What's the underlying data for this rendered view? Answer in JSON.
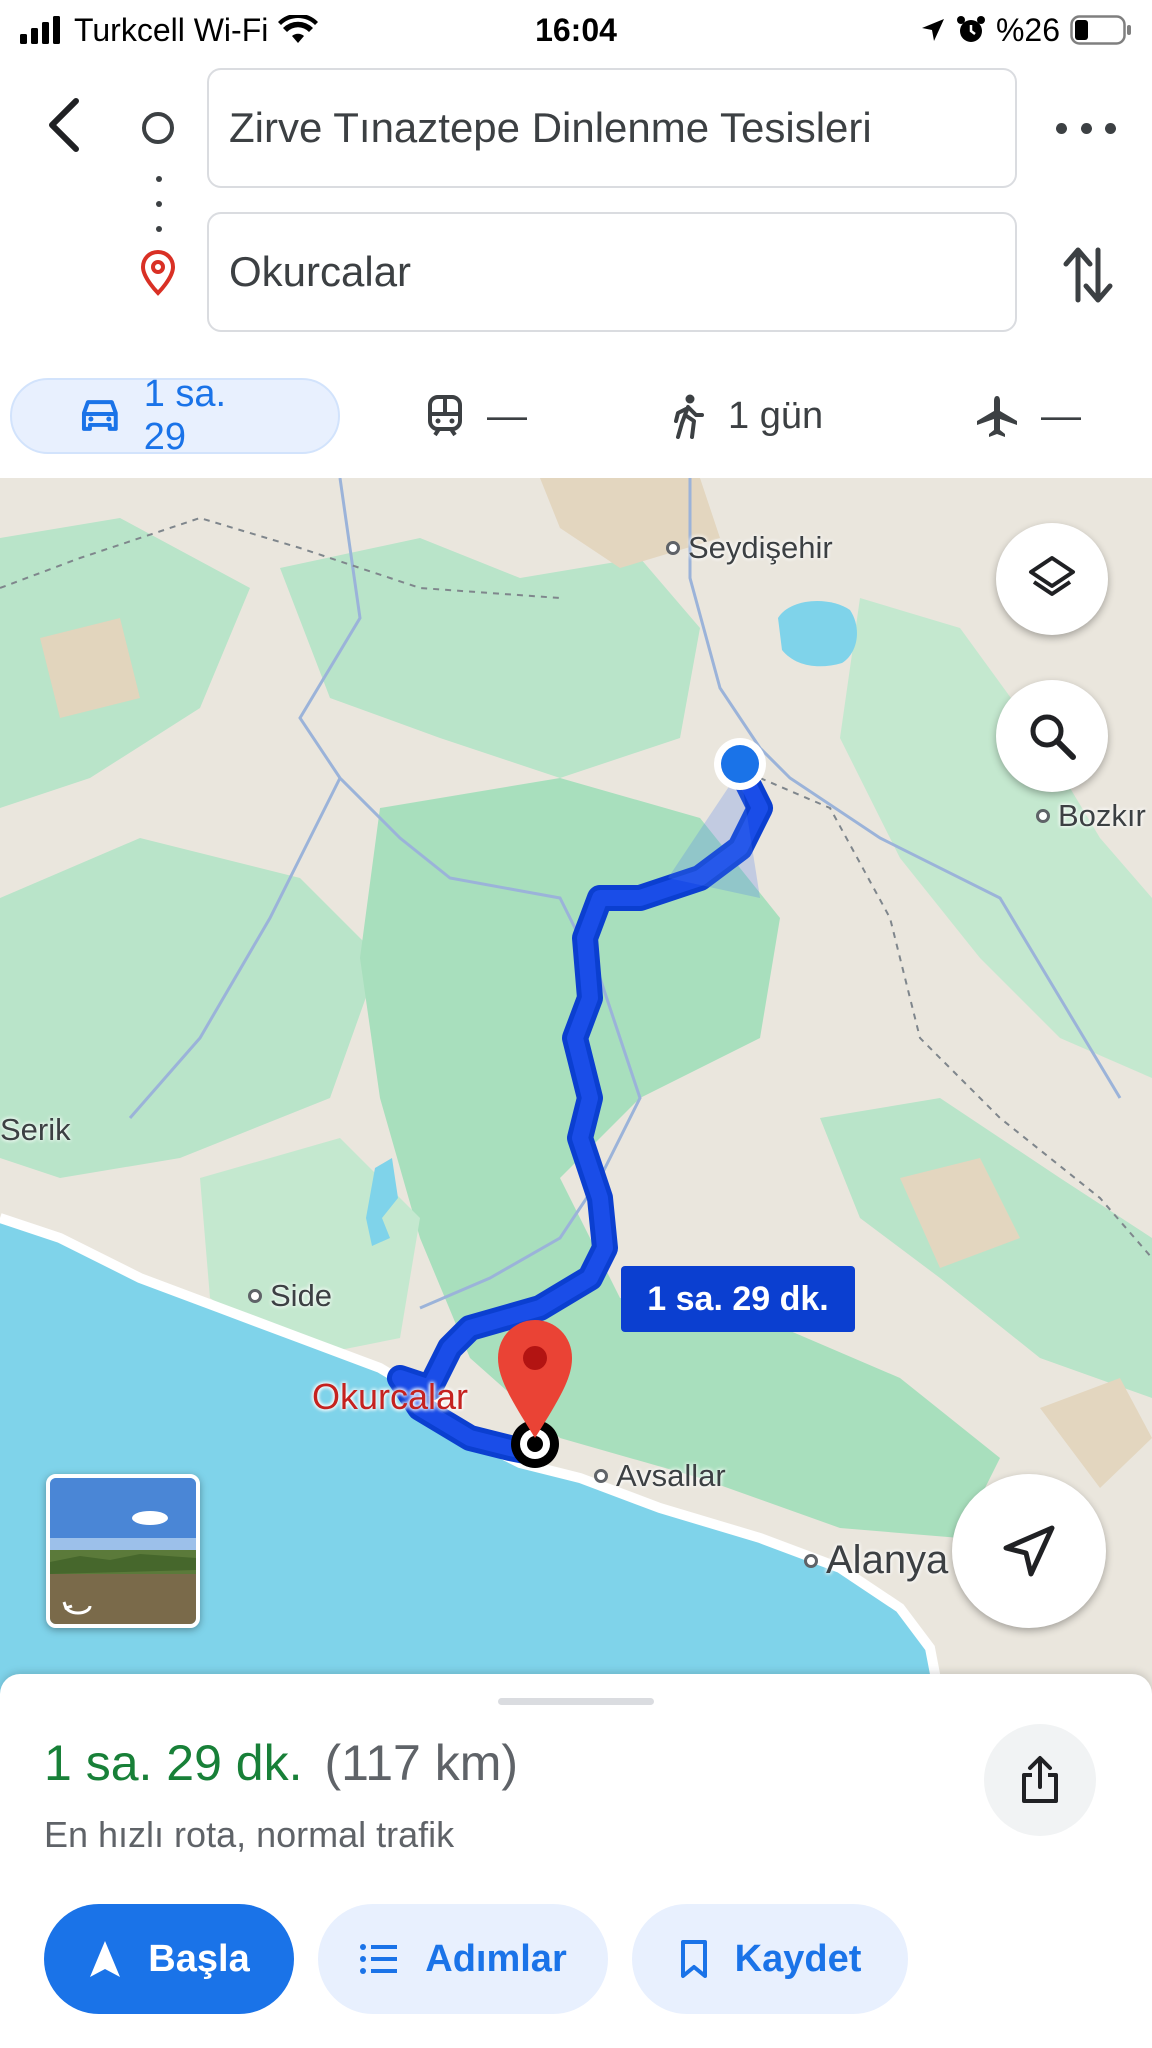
{
  "status_bar": {
    "carrier": "Turkcell Wi-Fi",
    "time": "16:04",
    "battery": "%26",
    "icons": [
      "signal-icon",
      "wifi-icon",
      "location-arrow-icon",
      "alarm-icon",
      "battery-icon"
    ]
  },
  "directions": {
    "origin": "Zirve Tınaztepe Dinlenme Tesisleri",
    "destination": "Okurcalar",
    "icons": [
      "back-icon",
      "origin-circle-icon",
      "destination-pin-icon",
      "more-icon",
      "swap-icon"
    ]
  },
  "modes": [
    {
      "name": "drive",
      "icon": "car-icon",
      "label": "1 sa. 29",
      "active": true
    },
    {
      "name": "transit",
      "icon": "train-icon",
      "label": "—",
      "active": false
    },
    {
      "name": "walk",
      "icon": "walk-icon",
      "label": "1 gün",
      "active": false
    },
    {
      "name": "flight",
      "icon": "plane-icon",
      "label": "—",
      "active": false
    }
  ],
  "map": {
    "places": {
      "seydisehir": "Seydişehir",
      "bozkir": "Bozkır",
      "serik": "Serik",
      "side": "Side",
      "avsallar": "Avsallar",
      "alanya": "Alanya",
      "okurcalar": "Okurcalar"
    },
    "route_time": "1 sa. 29 dk.",
    "route_color": "#1a3de8",
    "colors": {
      "land": "#eae6dd",
      "forest": "#b9e4c9",
      "water": "#7fd3ea"
    },
    "controls": [
      "layers-icon",
      "search-icon",
      "navigate-icon"
    ]
  },
  "summary": {
    "duration": "1 sa. 29 dk.",
    "distance": "(117 km)",
    "note": "En hızlı rota, normal trafik",
    "duration_color": "#188038"
  },
  "actions": {
    "start": "Başla",
    "steps": "Adımlar",
    "save": "Kaydet"
  }
}
